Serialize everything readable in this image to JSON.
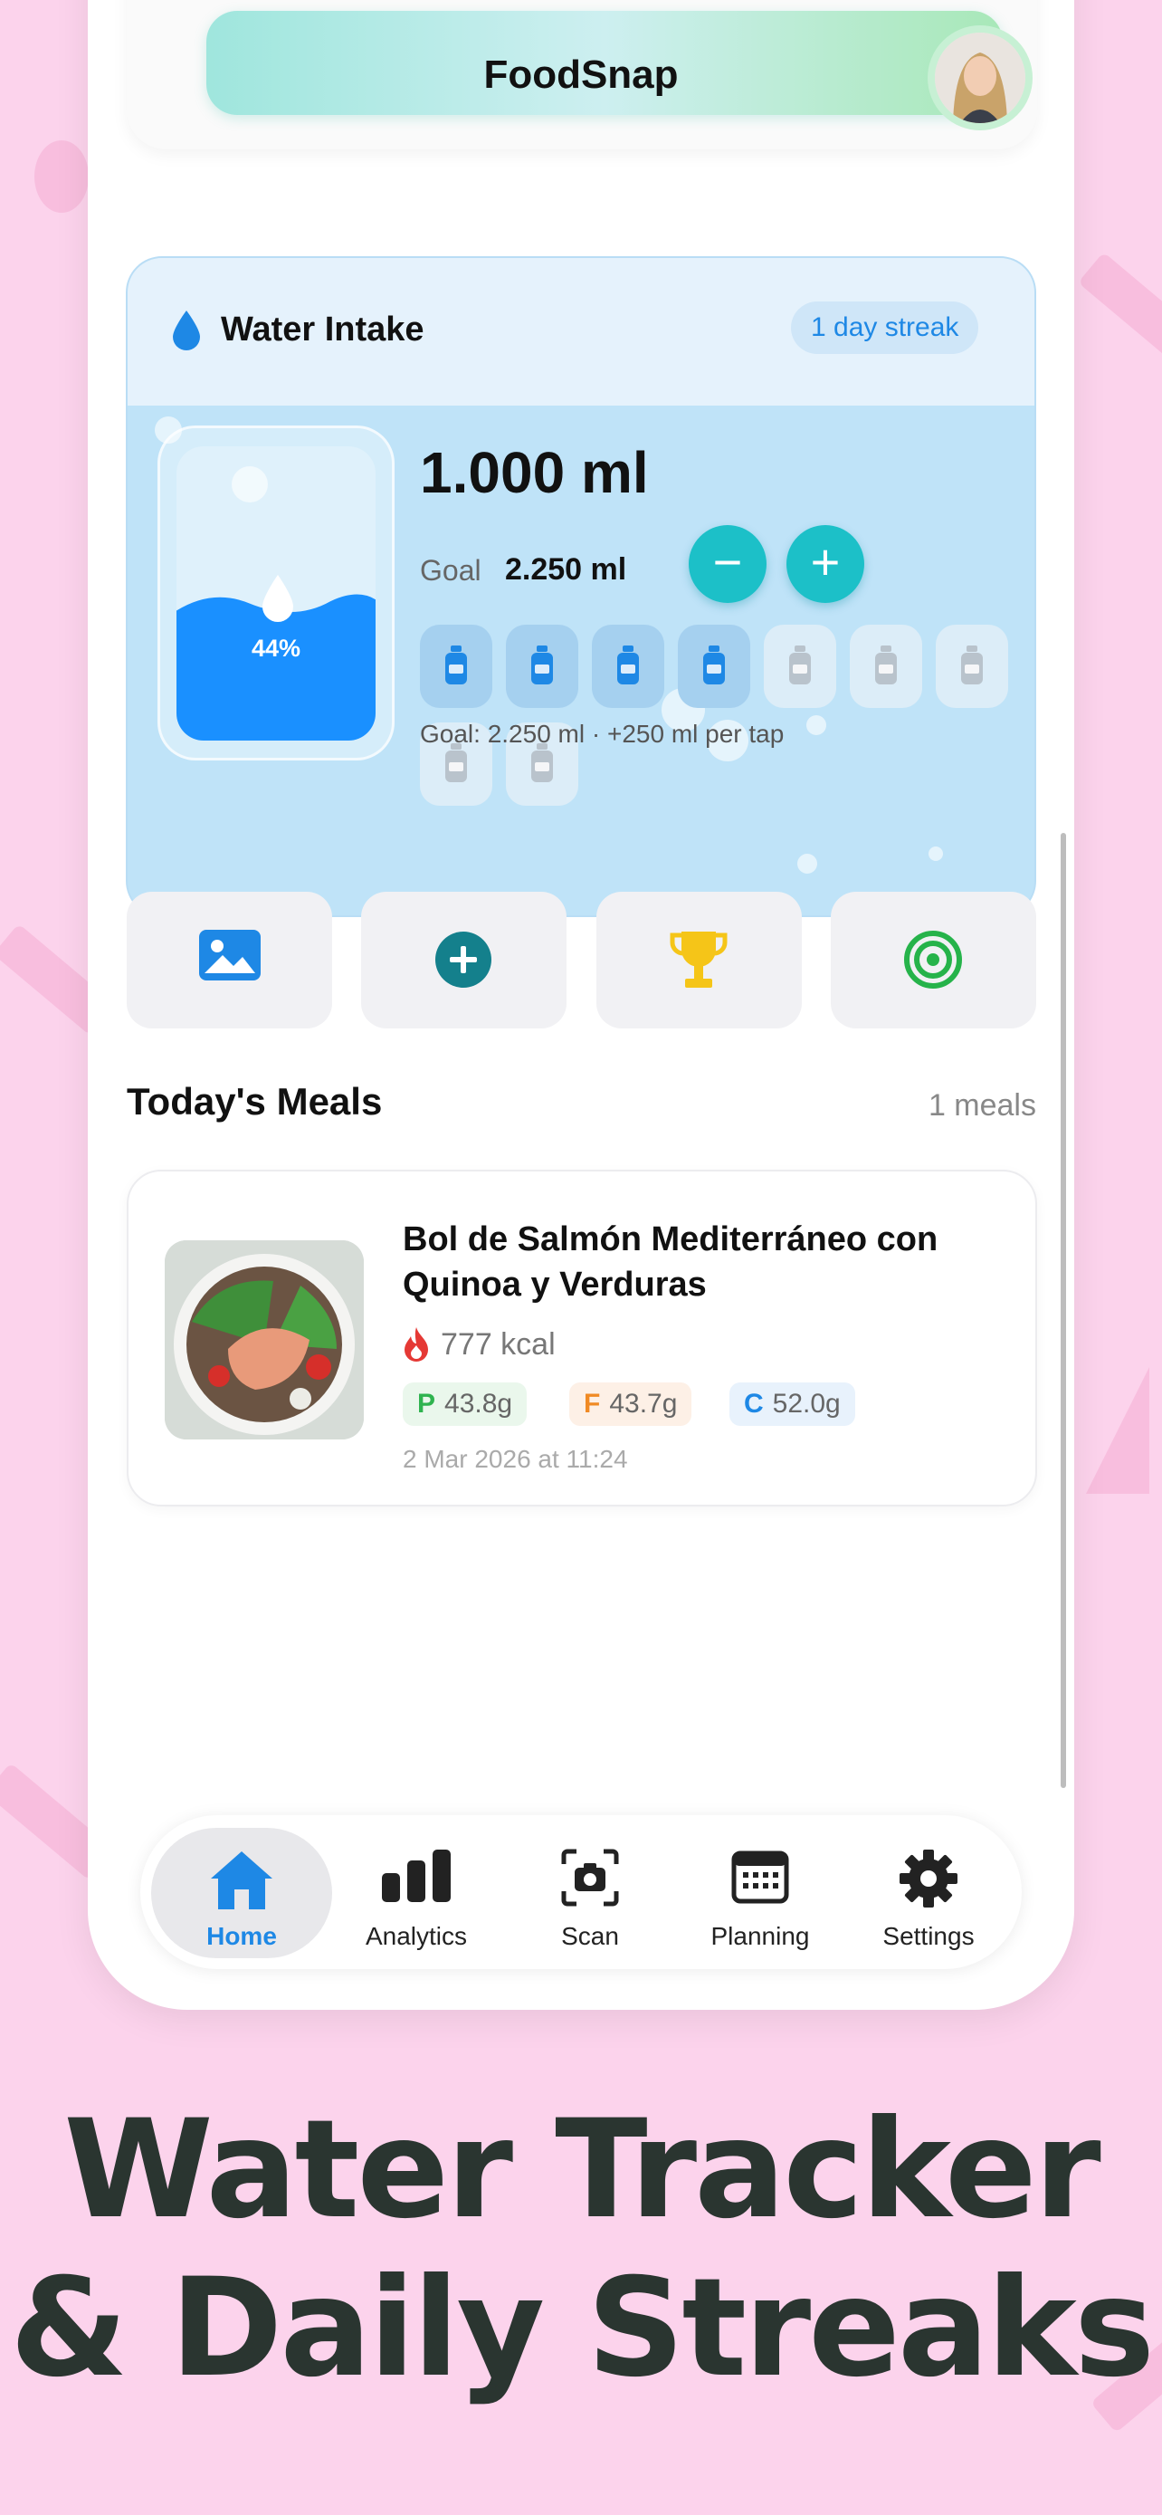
{
  "app": {
    "title": "FoodSnap"
  },
  "water": {
    "title": "Water Intake",
    "streak": "1 day streak",
    "amount": "1.000 ml",
    "goal_label": "Goal",
    "goal_value": "2.250 ml",
    "percent_label": "44%",
    "fill_fraction": 0.44,
    "minus_label": "−",
    "plus_label": "+",
    "cups_filled": 4,
    "cups_total": 9,
    "footer": "Goal: 2.250 ml · +250 ml per tap",
    "accent": "#1cc0c8",
    "fill_color": "#1a90ff"
  },
  "quick_actions": [
    {
      "icon": "image-icon"
    },
    {
      "icon": "add-circle-icon"
    },
    {
      "icon": "trophy-icon"
    },
    {
      "icon": "target-icon"
    }
  ],
  "meals": {
    "title": "Today's Meals",
    "count": "1 meals",
    "items": [
      {
        "name": "Bol de Salmón Mediterráneo con Quinoa y Verduras",
        "kcal": "777 kcal",
        "protein_letter": "P",
        "protein": "43.8g",
        "fat_letter": "F",
        "fat": "43.7g",
        "carb_letter": "C",
        "carbs": "52.0g",
        "date": "2 Mar 2026 at 11:24"
      }
    ]
  },
  "tabs": [
    {
      "label": "Home",
      "icon": "home-icon",
      "active": true
    },
    {
      "label": "Analytics",
      "icon": "bar-chart-icon"
    },
    {
      "label": "Scan",
      "icon": "camera-scan-icon"
    },
    {
      "label": "Planning",
      "icon": "calendar-icon"
    },
    {
      "label": "Settings",
      "icon": "gear-icon"
    }
  ],
  "headline": {
    "line1": "Water Tracker",
    "line2": "& Daily Streaks"
  },
  "colors": {
    "background": "#fcd3ec",
    "brand_blue": "#1e88e5"
  }
}
